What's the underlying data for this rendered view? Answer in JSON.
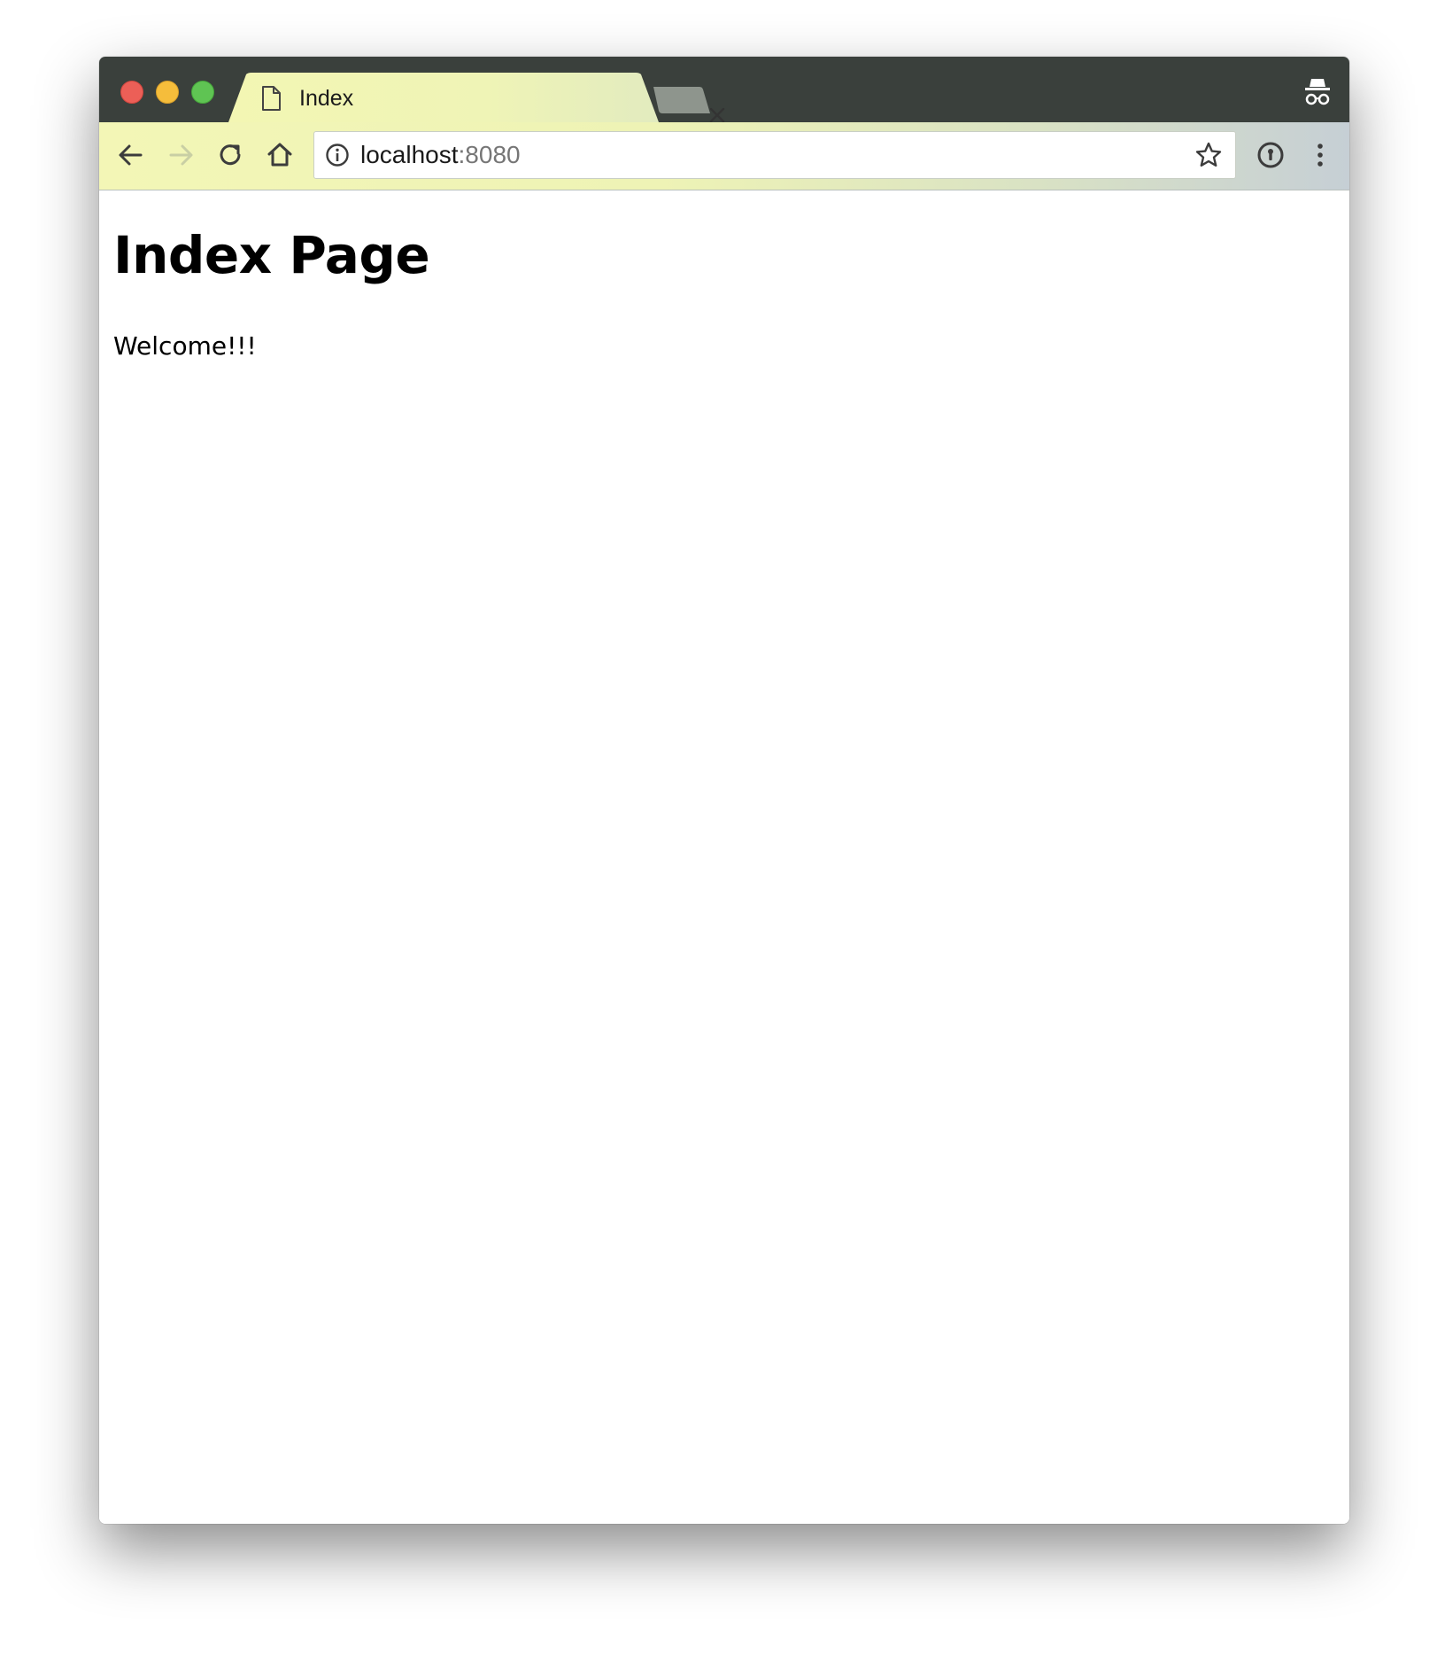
{
  "window": {
    "controls": [
      "close",
      "minimize",
      "maximize"
    ],
    "incognito_icon": "incognito-icon"
  },
  "tabs": [
    {
      "title": "Index",
      "icon": "file-icon",
      "active": true
    }
  ],
  "toolbar": {
    "back_icon": "back-arrow-icon",
    "forward_icon": "forward-arrow-icon",
    "reload_icon": "reload-icon",
    "home_icon": "home-icon",
    "extension_icon": "password-manager-icon",
    "menu_icon": "more-vert-icon"
  },
  "address_bar": {
    "host": "localhost",
    "port": ":8080",
    "info_icon": "info-icon",
    "bookmark_icon": "star-icon"
  },
  "page": {
    "heading": "Index Page",
    "text": "Welcome!!!"
  },
  "colors": {
    "tabstrip": "#3a403c",
    "toolbar_theme": "#eef3b5",
    "close": "#ec5f57",
    "minimize": "#f5bd3b",
    "maximize": "#5fc453"
  }
}
